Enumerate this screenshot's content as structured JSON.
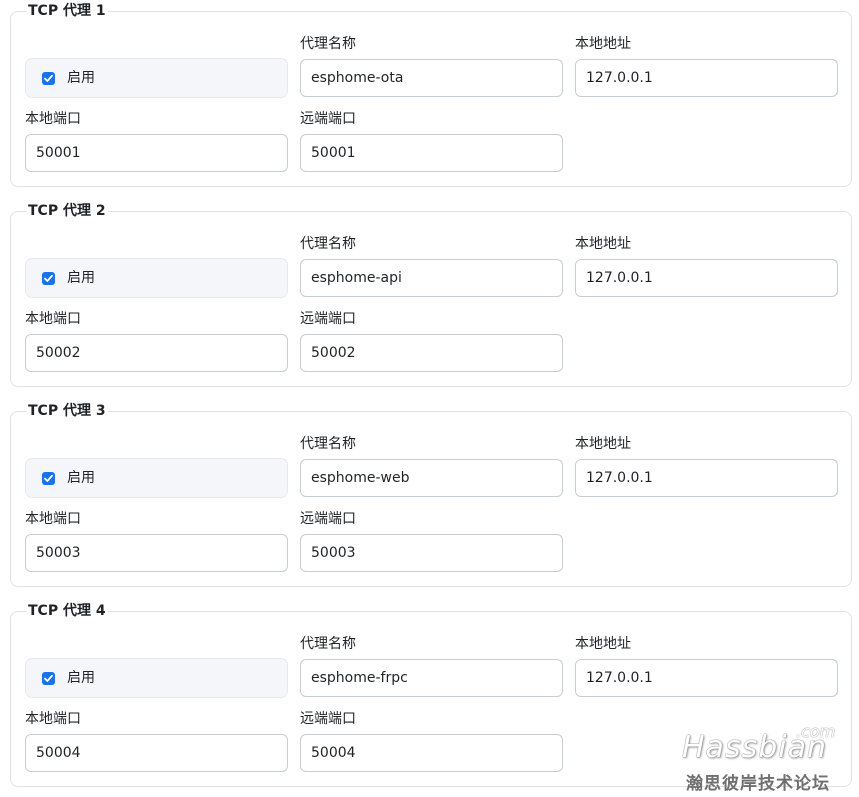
{
  "proxies": [
    {
      "title": "TCP 代理 1",
      "enabled": true,
      "enable_label": "启用",
      "name_label": "代理名称",
      "name_value": "esphome-ota",
      "local_addr_label": "本地地址",
      "local_addr_value": "127.0.0.1",
      "local_port_label": "本地端口",
      "local_port_value": "50001",
      "remote_port_label": "远端端口",
      "remote_port_value": "50001"
    },
    {
      "title": "TCP 代理 2",
      "enabled": true,
      "enable_label": "启用",
      "name_label": "代理名称",
      "name_value": "esphome-api",
      "local_addr_label": "本地地址",
      "local_addr_value": "127.0.0.1",
      "local_port_label": "本地端口",
      "local_port_value": "50002",
      "remote_port_label": "远端端口",
      "remote_port_value": "50002"
    },
    {
      "title": "TCP 代理 3",
      "enabled": true,
      "enable_label": "启用",
      "name_label": "代理名称",
      "name_value": "esphome-web",
      "local_addr_label": "本地地址",
      "local_addr_value": "127.0.0.1",
      "local_port_label": "本地端口",
      "local_port_value": "50003",
      "remote_port_label": "远端端口",
      "remote_port_value": "50003"
    },
    {
      "title": "TCP 代理 4",
      "enabled": true,
      "enable_label": "启用",
      "name_label": "代理名称",
      "name_value": "esphome-frpc",
      "local_addr_label": "本地地址",
      "local_addr_value": "127.0.0.1",
      "local_port_label": "本地端口",
      "local_port_value": "50004",
      "remote_port_label": "远端端口",
      "remote_port_value": "50004"
    }
  ],
  "watermark": {
    "domain": ".com",
    "brand": "Hassbian",
    "subtitle": "瀚思彼岸技术论坛"
  },
  "colors": {
    "checkbox_accent": "#1a73e8",
    "border": "#dfe3e8",
    "input_border": "#c8cdd3",
    "enable_bg": "#f4f6f9"
  }
}
